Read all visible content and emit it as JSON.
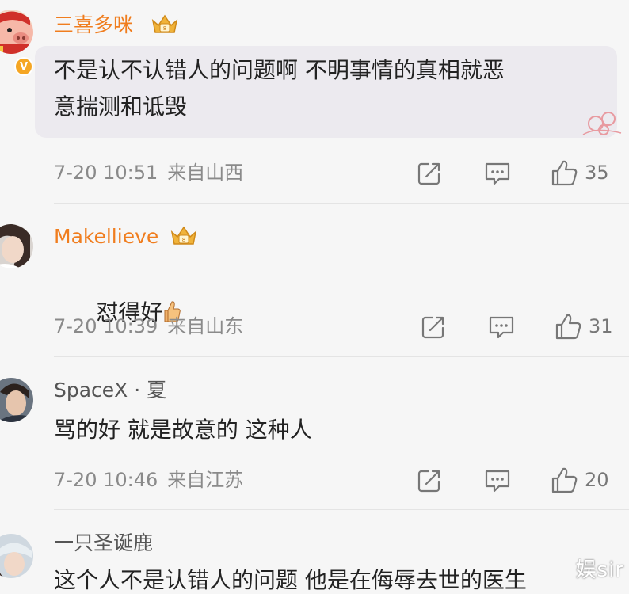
{
  "comments": [
    {
      "username": "三喜多咪",
      "text": "不是认不认错人的问题啊 不明事情的真相就恶\n意揣测和诋毁",
      "date": "7-20 10:51",
      "location": "来自山西",
      "likes": "35",
      "avatar_icon": "pig-cartoon-avatar",
      "verified_badge": "V"
    },
    {
      "username": "Makellieve",
      "text": "怼得好",
      "emoji": "thumbs-up-emoji",
      "date": "7-20 10:39",
      "location": "来自山东",
      "likes": "31",
      "avatar_icon": "girl-photo-avatar"
    },
    {
      "username": "SpaceX · 夏",
      "text": "骂的好 就是故意的 这种人",
      "date": "7-20 10:46",
      "location": "来自江苏",
      "likes": "20",
      "avatar_icon": "man-photo-avatar"
    },
    {
      "username": "一只圣诞鹿",
      "text": "这个人不是认错人的问题 他是在侮辱去世的医生",
      "avatar_icon": "girl-hat-photo-avatar"
    }
  ],
  "watermark": "娱sir",
  "colors": {
    "vip_name": "#f07d1e",
    "normal_name": "#555555",
    "body_text": "#222222",
    "meta_text": "#8a8a8a",
    "background": "#f6f6f6"
  }
}
